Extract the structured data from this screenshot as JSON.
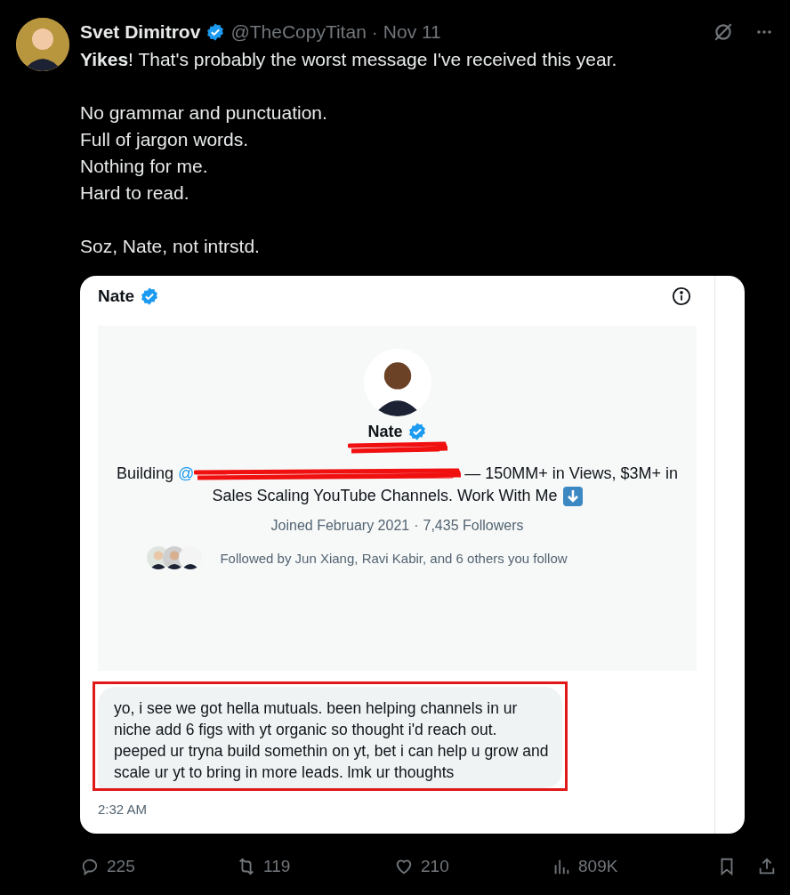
{
  "post": {
    "author": "Svet Dimitrov",
    "verified": true,
    "handle": "@TheCopyTitan",
    "separator": "·",
    "date": "Nov 11",
    "paragraphs": [
      "**Yikes**! That's probably the worst message I've received this year.",
      "No grammar and punctuation.\nFull of jargon words.\nNothing for me.\nHard to read.",
      "Soz, Nate, not intrstd."
    ]
  },
  "screenshot": {
    "name": "Nate",
    "verified": true,
    "profile": {
      "name": "Nate",
      "verified": true,
      "bio_start": "Building",
      "mention_start": "@",
      "bio_end": "— 150MM+ in Views, $3M+ in",
      "bio_line2": "Sales Scaling YouTube Channels. Work With Me",
      "joined": "Joined February 2021",
      "separator": "·",
      "followers": "7,435 Followers",
      "followed_by": "Followed by Jun Xiang, Ravi Kabir, and 6 others you follow"
    },
    "message": "yo, i see we got hella mutuals. been helping channels in ur niche add 6 figs with yt organic so thought i'd reach out. peeped ur tryna build somethin on yt, bet i can help u grow and scale ur yt to bring in more leads. lmk ur thoughts",
    "highlighted": true,
    "time": "2:32 AM"
  },
  "actions": [
    {
      "kind": "reply",
      "count": "225"
    },
    {
      "kind": "repost",
      "count": "119"
    },
    {
      "kind": "like",
      "count": "210"
    },
    {
      "kind": "views",
      "count": "809K"
    },
    {
      "kind": "bookmark"
    },
    {
      "kind": "share"
    }
  ]
}
